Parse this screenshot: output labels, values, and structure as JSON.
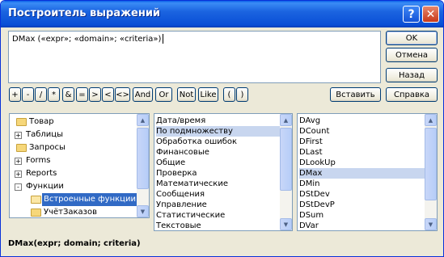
{
  "window": {
    "title": "Построитель выражений",
    "help_glyph": "?",
    "close_glyph": "✕"
  },
  "editor": {
    "expression": "DMax («expr»; «domain»; «criteria»)"
  },
  "side_buttons": {
    "ok": "OK",
    "cancel": "Отмена",
    "back": "Назад",
    "help": "Справка"
  },
  "operators": [
    "+",
    "-",
    "/",
    "*",
    "&",
    "=",
    ">",
    "<",
    "<>",
    "And",
    "Or",
    "Not",
    "Like",
    "(",
    ")"
  ],
  "paste_button": "Вставить",
  "tree": {
    "items": [
      {
        "label": "Товар",
        "expander": "",
        "icon": "folder-icon"
      },
      {
        "label": "Таблицы",
        "expander": "+",
        "icon": "folder-icon"
      },
      {
        "label": "Запросы",
        "expander": "",
        "icon": "folder-icon"
      },
      {
        "label": "Forms",
        "expander": "+",
        "icon": "folder-icon"
      },
      {
        "label": "Reports",
        "expander": "+",
        "icon": "folder-icon"
      },
      {
        "label": "Функции",
        "expander": "-",
        "icon": "folder-icon"
      },
      {
        "label": "Встроенные функции",
        "expander": "",
        "icon": "folder-open-icon",
        "selected": true
      },
      {
        "label": "УчётЗаказов",
        "expander": "",
        "icon": "folder-icon"
      }
    ]
  },
  "categories": {
    "items": [
      "Дата/время",
      "По подмножеству",
      "Обработка ошибок",
      "Финансовые",
      "Общие",
      "Проверка",
      "Математические",
      "Сообщения",
      "Управление",
      "Статистические",
      "Текстовые"
    ],
    "selected_index": 1
  },
  "functions": {
    "items": [
      "DAvg",
      "DCount",
      "DFirst",
      "DLast",
      "DLookUp",
      "DMax",
      "DMin",
      "DStDev",
      "DStDevP",
      "DSum",
      "DVar"
    ],
    "selected_index": 5
  },
  "status": {
    "syntax": "DMax(expr; domain; criteria)"
  },
  "colors": {
    "title_bar": "#0a4fd6",
    "selection": "#316ac5",
    "dialog_bg": "#ece9d8"
  }
}
